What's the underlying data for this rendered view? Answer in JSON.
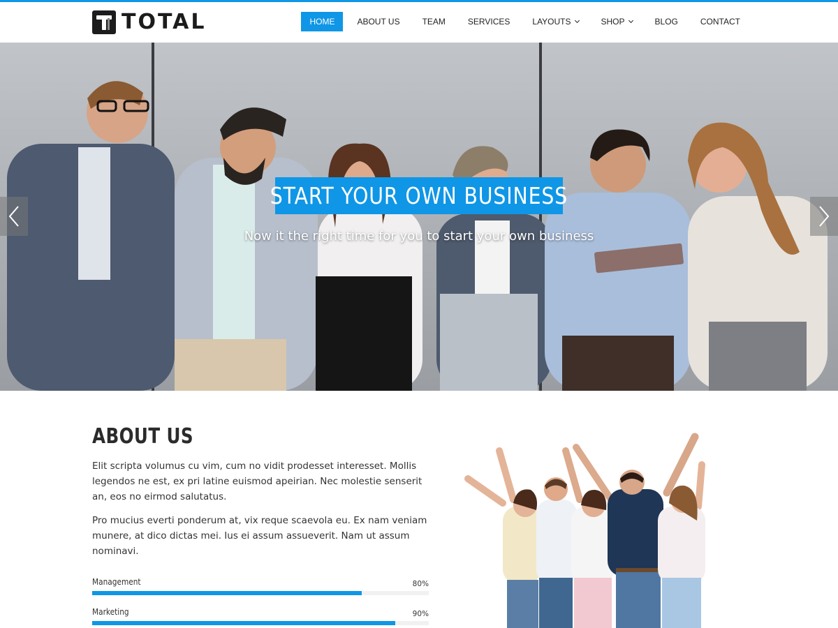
{
  "brand": {
    "name": "TOTAL",
    "accent_color": "#0f96e6"
  },
  "nav": {
    "items": [
      {
        "label": "HOME",
        "active": true
      },
      {
        "label": "ABOUT US",
        "active": false
      },
      {
        "label": "TEAM",
        "active": false
      },
      {
        "label": "SERVICES",
        "active": false
      },
      {
        "label": "LAYOUTS",
        "active": false,
        "has_dropdown": true
      },
      {
        "label": "SHOP",
        "active": false,
        "has_dropdown": true
      },
      {
        "label": "BLOG",
        "active": false
      },
      {
        "label": "CONTACT",
        "active": false
      }
    ]
  },
  "hero": {
    "title": "START YOUR OWN BUSINESS",
    "subtitle": "Now it the right time for you to start your own business",
    "prev_icon": "chevron-left-icon",
    "next_icon": "chevron-right-icon"
  },
  "about": {
    "title": "ABOUT US",
    "paragraphs": [
      "Elit scripta volumus cu vim, cum no vidit prodesset interesset. Mollis legendos ne est, ex pri latine euismod apeirian. Nec molestie senserit an, eos no eirmod salutatus.",
      "Pro mucius everti ponderum at, vix reque scaevola eu. Ex nam veniam munere, at dico dictas mei. Ius ei assum assueverit. Nam ut assum nominavi."
    ],
    "skills": [
      {
        "name": "Management",
        "percent_label": "80%",
        "value": 80
      },
      {
        "name": "Marketing",
        "percent_label": "90%",
        "value": 90
      }
    ]
  }
}
